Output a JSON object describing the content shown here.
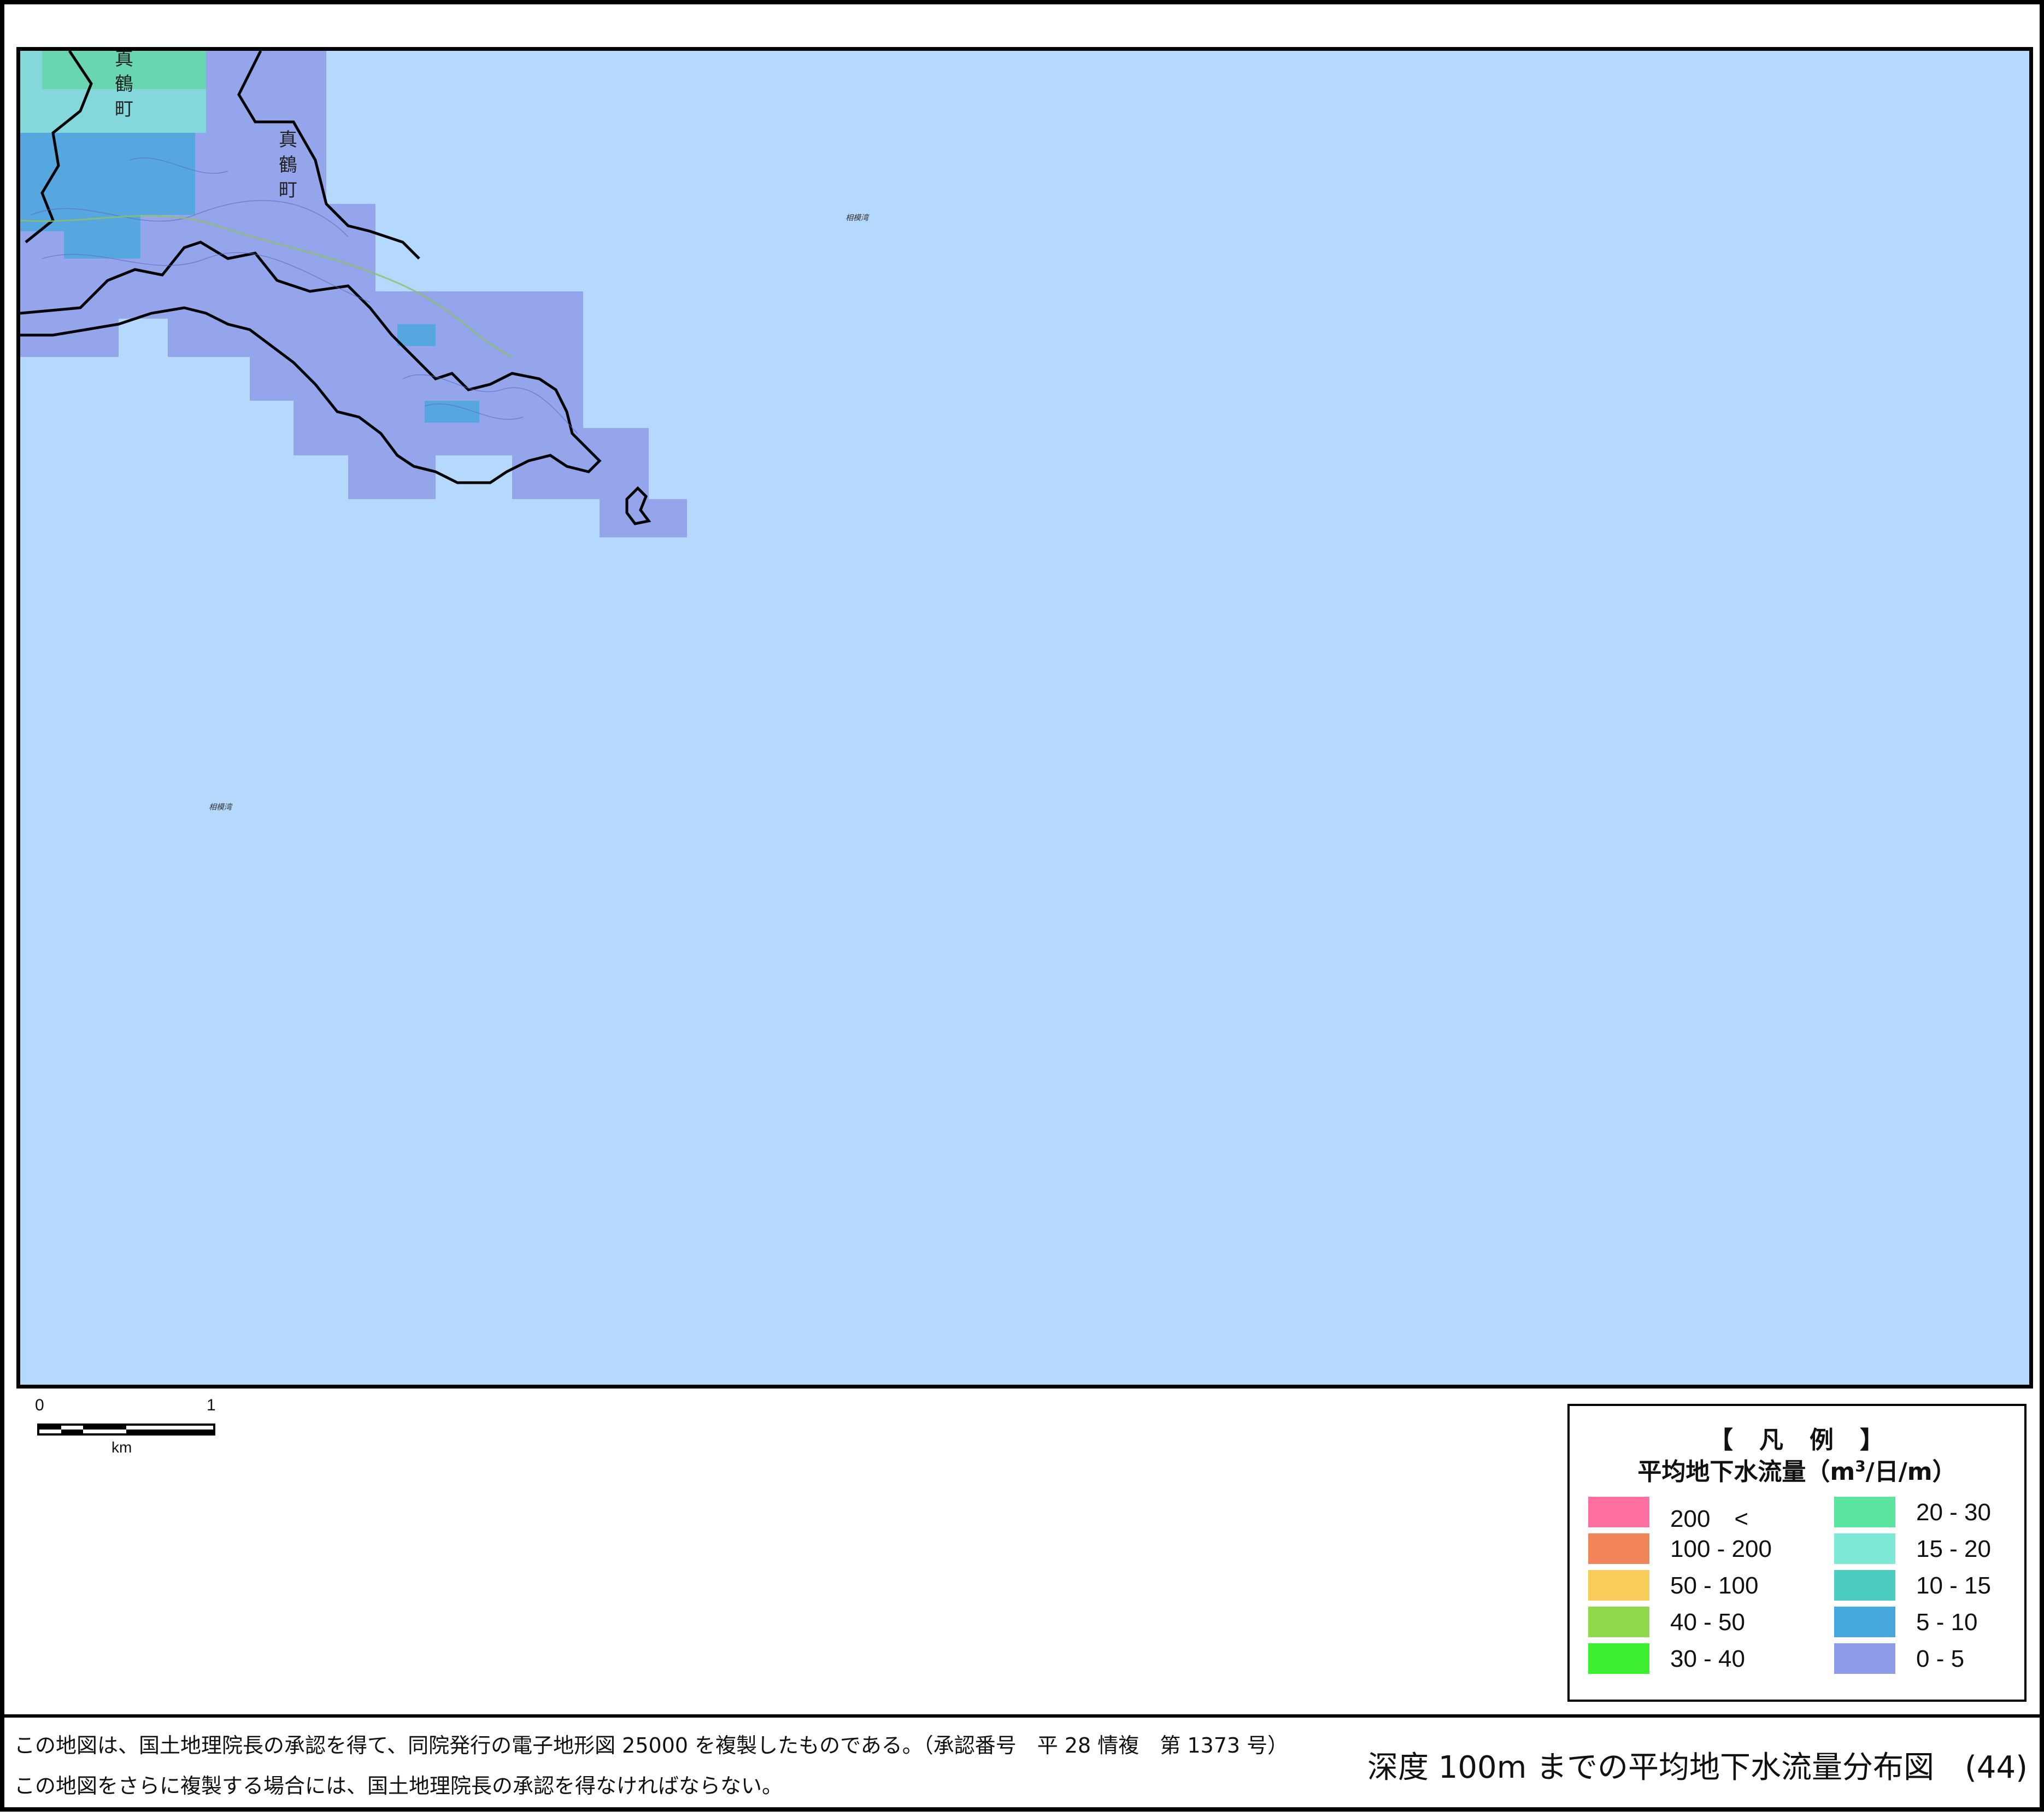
{
  "map": {
    "town_labels": [
      "真鶴町",
      "真鶴町"
    ],
    "sea_labels": [
      "相模湾",
      "相模湾"
    ],
    "colors": {
      "sea": "#b5d8fd",
      "land_0_5": "#8e9ce8",
      "land_5_10": "#46a8dd",
      "land_15_20": "#7fe9d8",
      "boundary": "#000000"
    }
  },
  "scale_bar": {
    "min_label": "0",
    "max_label": "1",
    "unit": "km"
  },
  "legend": {
    "title": "【　凡　例　】",
    "subtitle_prefix": "平均地下水流量（m",
    "subtitle_sup": "3",
    "subtitle_suffix": "/日/m）",
    "items": [
      {
        "label": "200　<",
        "color": "#ff6fa0"
      },
      {
        "label": "100 - 200",
        "color": "#f2845a"
      },
      {
        "label": "50 - 100",
        "color": "#f7cc58"
      },
      {
        "label": "40 - 50",
        "color": "#8fd94a"
      },
      {
        "label": "30 - 40",
        "color": "#3cf031"
      },
      {
        "label": "20 - 30",
        "color": "#5ce59f"
      },
      {
        "label": "15 - 20",
        "color": "#7fe9d8"
      },
      {
        "label": "10 - 15",
        "color": "#4dcdc2"
      },
      {
        "label": "5 - 10",
        "color": "#46a8dd"
      },
      {
        "label": "0 - 5",
        "color": "#8e9ce8"
      }
    ]
  },
  "footer": {
    "note1": "この地図は、国土地理院長の承認を得て、同院発行の電子地形図 25000 を複製したものである。（承認番号　平 28 情複　第 1373 号）",
    "note2": "この地図をさらに複製する場合には、国土地理院長の承認を得なければならない。",
    "map_title": "深度 100m までの平均地下水流量分布図　(44)"
  }
}
